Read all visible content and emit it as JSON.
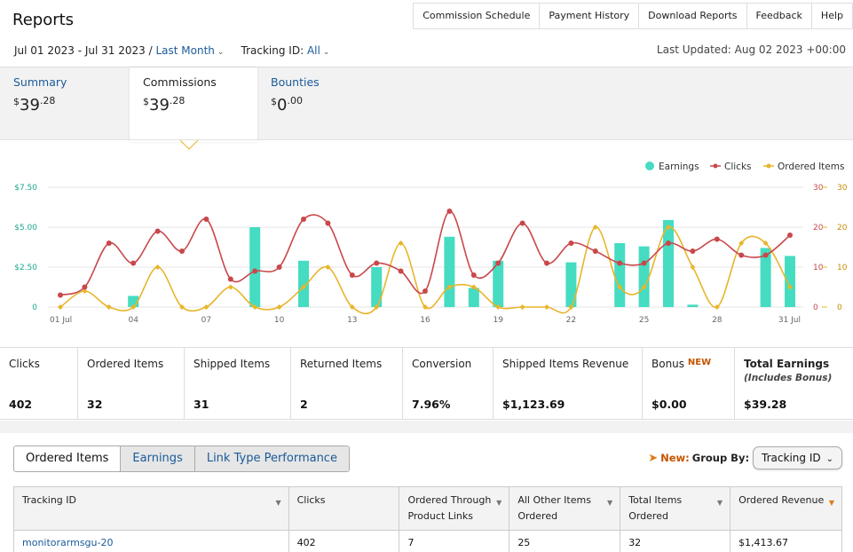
{
  "page_title": "Reports",
  "top_nav": [
    "Commission Schedule",
    "Payment History",
    "Download Reports",
    "Feedback",
    "Help"
  ],
  "filters": {
    "date_range": "Jul 01 2023 - Jul 31 2023 /",
    "period": "Last Month",
    "tracking_label": "Tracking ID:",
    "tracking_value": "All"
  },
  "last_updated": "Last Updated: Aug 02 2023 +00:00",
  "summary_tabs": [
    {
      "label": "Summary",
      "currency": "$",
      "whole": "39",
      "cents": ".28"
    },
    {
      "label": "Commissions",
      "currency": "$",
      "whole": "39",
      "cents": ".28"
    },
    {
      "label": "Bounties",
      "currency": "$",
      "whole": "0",
      "cents": ".00"
    }
  ],
  "chart_data": {
    "type": "bar+line",
    "legend": [
      "Earnings",
      "Clicks",
      "Ordered Items"
    ],
    "legend_placement": "top-right",
    "colors": {
      "earnings": "#45dcc1",
      "clicks": "#c9474b",
      "ordered_items": "#e8b52a",
      "grid": "#e4e4e4"
    },
    "x_tick_labels": [
      "01 Jul",
      "04",
      "07",
      "10",
      "13",
      "16",
      "19",
      "22",
      "25",
      "28",
      "31 Jul"
    ],
    "days": [
      1,
      2,
      3,
      4,
      5,
      6,
      7,
      8,
      9,
      10,
      11,
      12,
      13,
      14,
      15,
      16,
      17,
      18,
      19,
      20,
      21,
      22,
      23,
      24,
      25,
      26,
      27,
      28,
      29,
      30,
      31
    ],
    "y_left_ticks": [
      "$7.50",
      "$5.00",
      "$2.50",
      "0"
    ],
    "y_left_range": [
      0,
      7.5
    ],
    "y_right_ticks": [
      "30",
      "20",
      "10",
      "0"
    ],
    "y_right_range": [
      0,
      30
    ],
    "grid": true,
    "earnings": [
      0,
      0,
      0,
      0.7,
      0,
      0,
      0,
      0,
      5.0,
      0,
      2.9,
      0,
      0,
      2.5,
      0,
      0,
      4.4,
      1.2,
      2.9,
      0,
      0,
      2.8,
      0,
      4.0,
      3.8,
      5.45,
      0.15,
      0,
      0,
      3.7,
      3.2
    ],
    "clicks": [
      3,
      5,
      16,
      11,
      19,
      14,
      22,
      7,
      9,
      10,
      22,
      21,
      8,
      11,
      9,
      4,
      24,
      8,
      11,
      21,
      11,
      16,
      14,
      11,
      11,
      16,
      14,
      17,
      13,
      13,
      18
    ],
    "ordered_items": [
      0,
      4,
      0,
      0,
      10,
      0,
      0,
      5,
      0,
      0,
      5,
      10,
      0,
      0,
      16,
      0,
      5,
      5,
      0,
      0,
      0,
      0,
      20,
      5,
      5,
      20,
      10,
      0,
      16,
      16,
      5
    ]
  },
  "metrics": [
    {
      "label": "Clicks",
      "value": "402"
    },
    {
      "label": "Ordered Items",
      "value": "32"
    },
    {
      "label": "Shipped Items",
      "value": "31"
    },
    {
      "label": "Returned Items",
      "value": "2"
    },
    {
      "label": "Conversion",
      "value": "7.96%"
    },
    {
      "label": "Shipped Items Revenue",
      "value": "$1,123.69"
    },
    {
      "label": "Bonus",
      "badge": "NEW",
      "value": "$0.00"
    },
    {
      "label": "Total Earnings",
      "sublabel": "(Includes Bonus)",
      "value": "$39.28"
    }
  ],
  "sub_tabs": [
    "Ordered Items",
    "Earnings",
    "Link Type Performance"
  ],
  "group_by": {
    "new_label": "New:",
    "label": "Group By:",
    "value": "Tracking ID"
  },
  "table": {
    "headers": [
      "Tracking ID",
      "Clicks",
      "Ordered Through Product Links",
      "All Other Items Ordered",
      "Total Items Ordered",
      "Ordered Revenue"
    ],
    "rows": [
      [
        "monitorarmsgu-20",
        "402",
        "7",
        "25",
        "32",
        "$1,413.67"
      ]
    ]
  }
}
